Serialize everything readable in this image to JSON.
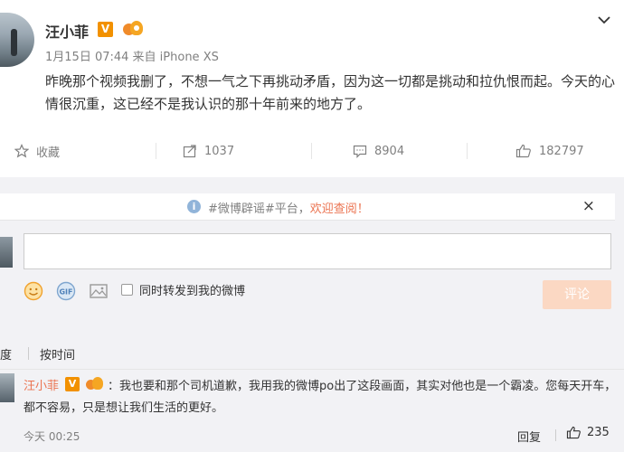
{
  "post": {
    "author": "汪小菲",
    "verified_badge": "V",
    "meta": "1月15日 07:44 来自 iPhone XS",
    "content": "昨晚那个视频我删了，不想一气之下再挑动矛盾，因为这一切都是挑动和拉仇恨而起。今天的心情很沉重，这已经不是我认识的那十年前来的地方了。"
  },
  "actions": {
    "favorite": "收藏",
    "repost_count": "1037",
    "comment_count": "8904",
    "like_count": "182797"
  },
  "notice": {
    "prefix": "#微博辟谣#平台，",
    "highlight": "欢迎查阅！",
    "close": "×"
  },
  "composer": {
    "forward_label": "同时转发到我的微博",
    "submit": "评论"
  },
  "sort": {
    "hot": "热度",
    "time": "按时间"
  },
  "comment": {
    "author": "汪小菲",
    "verified_badge": "V",
    "text": "：我也要和那个司机道歉，我用我的微博po出了这段画面，其实对他也是一个霸凌。您每天开车，都不容易，只是想让我们生活的更好。",
    "time": "今天 00:25",
    "reply": "回复",
    "likes": "235"
  },
  "colors": {
    "accent": "#eb7350",
    "badge_orange": "#f29100",
    "submit_disabled": "#fbd8c3"
  }
}
